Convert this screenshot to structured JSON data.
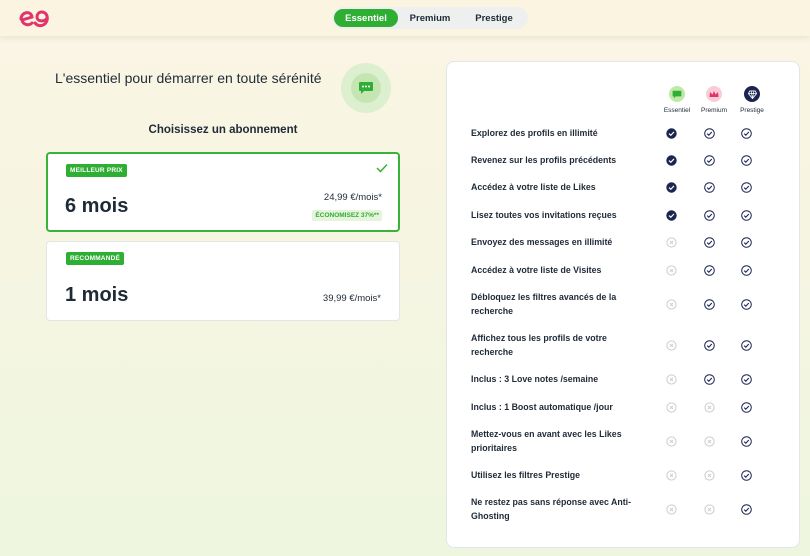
{
  "header": {
    "tabs": [
      {
        "label": "Essentiel",
        "active": true
      },
      {
        "label": "Premium",
        "active": false
      },
      {
        "label": "Prestige",
        "active": false
      }
    ]
  },
  "left": {
    "headline": "L'essentiel pour démarrer en toute sérénité",
    "subtitle": "Choisissez un abonnement",
    "plans": [
      {
        "badge": "MEILLEUR PRIX",
        "duration": "6 mois",
        "price": "24,99 €/mois*",
        "savings": "ÉCONOMISEZ 37%**",
        "selected": true
      },
      {
        "badge": "RECOMMANDÉ",
        "duration": "1 mois",
        "price": "39,99 €/mois*",
        "selected": false
      }
    ]
  },
  "compare": {
    "columns": [
      {
        "label": "Essentiel",
        "icon": "chat-bubble-icon",
        "color": "#8bd46d"
      },
      {
        "label": "Premium",
        "icon": "crown-icon",
        "color": "#f6b3c2"
      },
      {
        "label": "Prestige",
        "icon": "diamond-icon",
        "color": "#1b2550"
      }
    ],
    "features": [
      {
        "label": "Explorez des profils en illimité",
        "marks": [
          "filled",
          "outline",
          "outline"
        ]
      },
      {
        "label": "Revenez sur les profils précédents",
        "marks": [
          "filled",
          "outline",
          "outline"
        ]
      },
      {
        "label": "Accédez à votre liste de Likes",
        "marks": [
          "filled",
          "outline",
          "outline"
        ]
      },
      {
        "label": "Lisez toutes vos invitations reçues",
        "marks": [
          "filled",
          "outline",
          "outline"
        ]
      },
      {
        "label": "Envoyez des messages en illimité",
        "marks": [
          "none",
          "outline",
          "outline"
        ]
      },
      {
        "label": "Accédez à votre liste de Visites",
        "marks": [
          "none",
          "outline",
          "outline"
        ]
      },
      {
        "label": "Débloquez les filtres avancés de la recherche",
        "marks": [
          "none",
          "outline",
          "outline"
        ]
      },
      {
        "label": "Affichez tous les profils de votre recherche",
        "marks": [
          "none",
          "outline",
          "outline"
        ]
      },
      {
        "label": "Inclus : 3 Love notes /semaine",
        "marks": [
          "none",
          "outline",
          "outline"
        ]
      },
      {
        "label": "Inclus : 1 Boost automatique /jour",
        "marks": [
          "none",
          "none",
          "outline"
        ]
      },
      {
        "label": "Mettez-vous en avant avec les Likes prioritaires",
        "marks": [
          "none",
          "none",
          "outline"
        ]
      },
      {
        "label": "Utilisez les filtres Prestige",
        "marks": [
          "none",
          "none",
          "outline"
        ]
      },
      {
        "label": "Ne restez pas sans réponse avec Anti-Ghosting",
        "marks": [
          "none",
          "none",
          "outline"
        ]
      }
    ]
  },
  "colors": {
    "accent": "#2fae34",
    "navy": "#1b2550",
    "muted": "#c9cdd2"
  }
}
